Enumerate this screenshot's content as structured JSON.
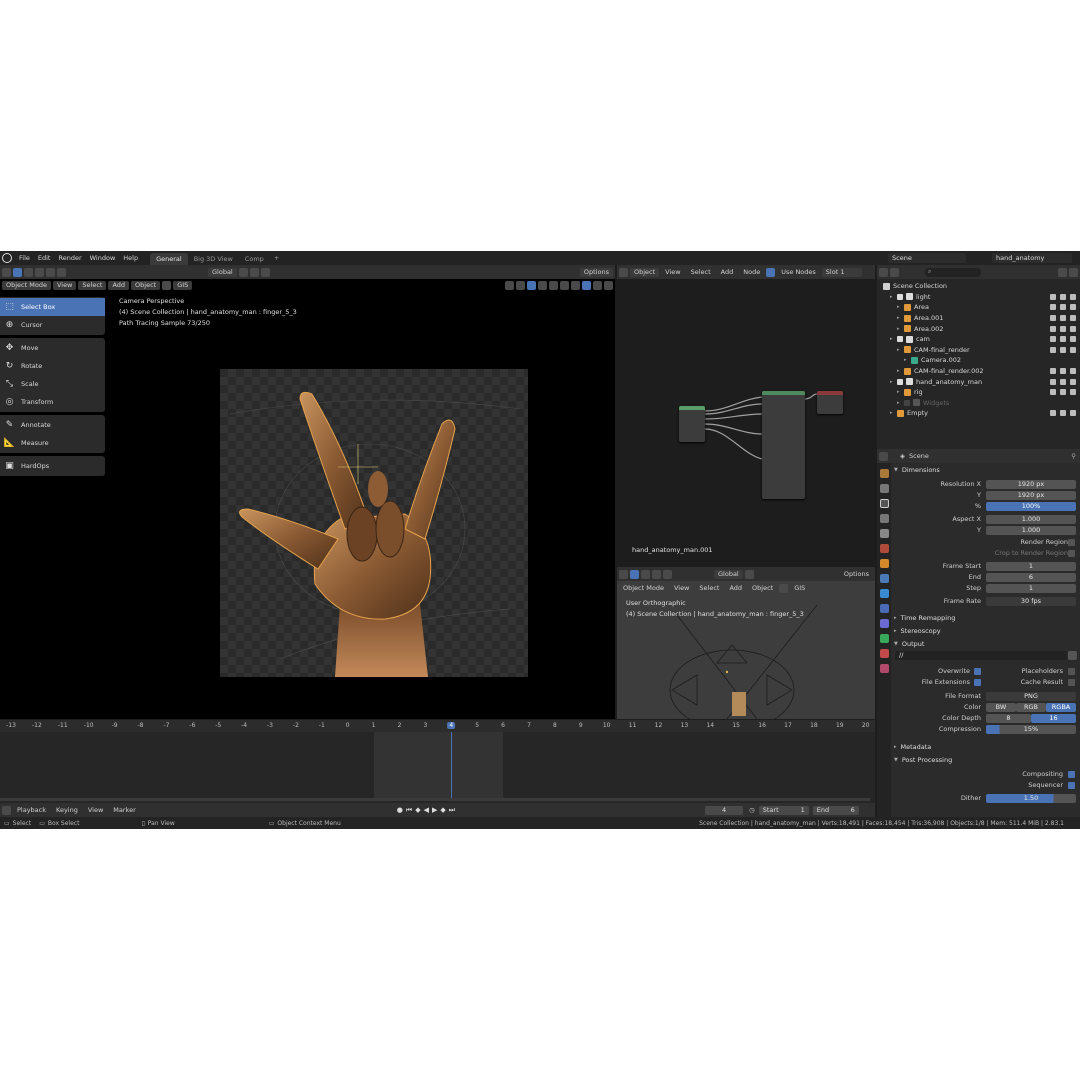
{
  "menubar": {
    "menus": [
      "File",
      "Edit",
      "Render",
      "Window",
      "Help"
    ],
    "workspaces": [
      "General",
      "Big 3D View",
      "Comp"
    ],
    "add_tab": "+",
    "scene": "Scene",
    "view_layer": "hand_anatomy"
  },
  "viewport": {
    "header": {
      "transform": "Global",
      "options": "Options"
    },
    "header2": {
      "mode": "Object Mode",
      "view": "View",
      "select": "Select",
      "add": "Add",
      "object": "Object",
      "gis": "GIS"
    },
    "overlay": {
      "line1": "Camera Perspective",
      "line2": "(4) Scene Collection | hand_anatomy_man : finger_5_3",
      "line3": "Path Tracing Sample 73/250"
    },
    "tools": [
      "Select Box",
      "Cursor",
      "Move",
      "Rotate",
      "Scale",
      "Transform",
      "Annotate",
      "Measure",
      "HardOps"
    ]
  },
  "node_editor": {
    "header": {
      "type": "Object",
      "view": "View",
      "select": "Select",
      "add": "Add",
      "node": "Node",
      "use_nodes": "Use Nodes",
      "slot": "Slot 1"
    },
    "object_name": "hand_anatomy_man.001"
  },
  "viewport2": {
    "header": {
      "transform": "Global",
      "options": "Options"
    },
    "header2": {
      "mode": "Object Mode",
      "view": "View",
      "select": "Select",
      "add": "Add",
      "object": "Object",
      "gis": "GIS"
    },
    "overlay": {
      "line1": "User Orthographic",
      "line2": "(4) Scene Collection | hand_anatomy_man : finger_5_3"
    }
  },
  "timeline": {
    "ticks": [
      "-13",
      "-12",
      "-11",
      "-10",
      "-9",
      "-8",
      "-7",
      "-6",
      "-5",
      "-4",
      "-3",
      "-2",
      "-1",
      "0",
      "1",
      "2",
      "3",
      "4",
      "5",
      "6",
      "7",
      "8",
      "9",
      "10",
      "11",
      "12",
      "13",
      "14",
      "15",
      "16",
      "17",
      "18",
      "19",
      "20"
    ],
    "current_frame": 4,
    "frame_start": 1,
    "frame_end": 6,
    "menus": {
      "playback": "Playback",
      "keying": "Keying",
      "view": "View",
      "marker": "Marker"
    },
    "current_label": "4",
    "start_label": "Start",
    "start_value": "1",
    "end_label": "End",
    "end_value": "6"
  },
  "statusbar": {
    "select": "Select",
    "box_select": "Box Select",
    "pan_view": "Pan View",
    "context_menu": "Object Context Menu",
    "stats": "Scene Collection | hand_anatomy_man | Verts:18,491 | Faces:18,454 | Tris:36,908 | Objects:1/8 | Mem: 511.4 MiB | 2.83.1"
  },
  "outliner": {
    "root": "Scene Collection",
    "items": [
      {
        "name": "light",
        "kind": "collection"
      },
      {
        "name": "Area",
        "kind": "light"
      },
      {
        "name": "Area.001",
        "kind": "light"
      },
      {
        "name": "Area.002",
        "kind": "light"
      },
      {
        "name": "cam",
        "kind": "collection"
      },
      {
        "name": "CAM-final_render",
        "kind": "camera"
      },
      {
        "name": "Camera.002",
        "kind": "camera-data"
      },
      {
        "name": "CAM-final_render.002",
        "kind": "camera"
      },
      {
        "name": "hand_anatomy_man",
        "kind": "collection"
      },
      {
        "name": "rig",
        "kind": "armature"
      },
      {
        "name": "Widgets",
        "kind": "collection-disabled"
      },
      {
        "name": "Empty",
        "kind": "empty"
      }
    ]
  },
  "properties": {
    "context": "Scene",
    "dimensions": {
      "title": "Dimensions",
      "res_x_label": "Resolution X",
      "res_x": "1920 px",
      "res_y_label": "Y",
      "res_y": "1920 px",
      "res_pct_label": "%",
      "res_pct": "100%",
      "aspect_x_label": "Aspect X",
      "aspect_x": "1.000",
      "aspect_y_label": "Y",
      "aspect_y": "1.000",
      "render_region": "Render Region",
      "crop": "Crop to Render Region",
      "frame_start_label": "Frame Start",
      "frame_start": "1",
      "end_label": "End",
      "end": "6",
      "step_label": "Step",
      "step": "1",
      "frame_rate_label": "Frame Rate",
      "frame_rate": "30 fps"
    },
    "time_remapping": "Time Remapping",
    "stereoscopy": "Stereoscopy",
    "output": {
      "title": "Output",
      "path": "//",
      "overwrite": "Overwrite",
      "placeholders": "Placeholders",
      "file_extensions": "File Extensions",
      "cache_result": "Cache Result",
      "file_format_label": "File Format",
      "file_format": "PNG",
      "color_label": "Color",
      "color_options": [
        "BW",
        "RGB",
        "RGBA"
      ],
      "color_depth_label": "Color Depth",
      "color_depth_options": [
        "8",
        "16"
      ],
      "compression_label": "Compression",
      "compression": "15%",
      "compression_value": 0.15
    },
    "metadata": "Metadata",
    "post_processing": {
      "title": "Post Processing",
      "compositing": "Compositing",
      "sequencer": "Sequencer",
      "dither_label": "Dither",
      "dither": "1.50"
    }
  }
}
